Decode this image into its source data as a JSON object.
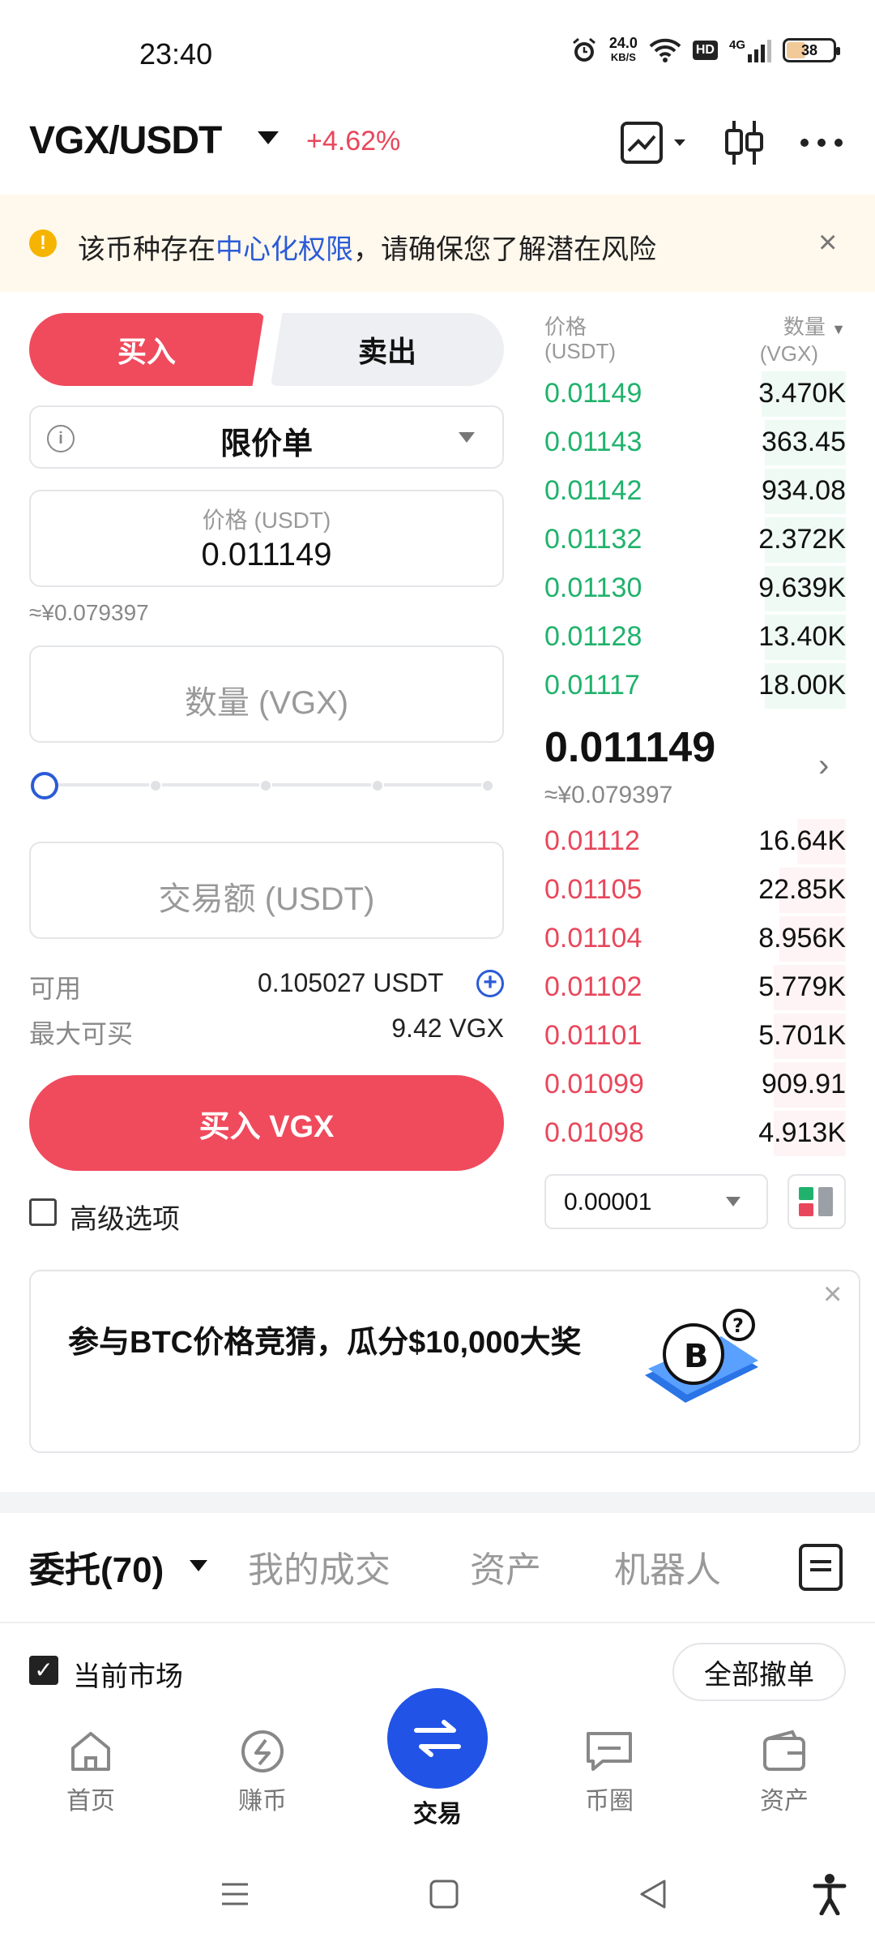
{
  "status_bar": {
    "time": "23:40",
    "net_speed_top": "24.0",
    "net_speed_unit": "KB/S",
    "hd": "HD",
    "network": "4G",
    "battery": "38"
  },
  "header": {
    "pair": "VGX/USDT",
    "change": "+4.62%"
  },
  "notice": {
    "text_before": "该币种存在",
    "link": "中心化权限",
    "text_after": "，请确保您了解潜在风险"
  },
  "order_form": {
    "buy_tab": "买入",
    "sell_tab": "卖出",
    "order_type": "限价单",
    "price_placeholder": "价格 (USDT)",
    "price_value": "0.011149",
    "price_cny": "≈¥0.079397",
    "qty_placeholder": "数量 (VGX)",
    "amount_placeholder": "交易额 (USDT)",
    "available_label": "可用",
    "available_value": "0.105027 USDT",
    "max_buy_label": "最大可买",
    "max_buy_value": "9.42 VGX",
    "buy_button": "买入 VGX",
    "advanced_label": "高级选项",
    "slider_position": 0
  },
  "orderbook": {
    "price_header": "价格",
    "price_unit": "(USDT)",
    "qty_header": "数量",
    "qty_unit": "(VGX)",
    "asks": [
      {
        "price": "0.01149",
        "qty": "3.470K",
        "depth": 0.28
      },
      {
        "price": "0.01143",
        "qty": "363.45",
        "depth": 0.27
      },
      {
        "price": "0.01142",
        "qty": "934.08",
        "depth": 0.27
      },
      {
        "price": "0.01132",
        "qty": "2.372K",
        "depth": 0.27
      },
      {
        "price": "0.01130",
        "qty": "9.639K",
        "depth": 0.27
      },
      {
        "price": "0.01128",
        "qty": "13.40K",
        "depth": 0.27
      },
      {
        "price": "0.01117",
        "qty": "18.00K",
        "depth": 0.27
      }
    ],
    "last_price": "0.011149",
    "last_price_cny": "≈¥0.079397",
    "bids": [
      {
        "price": "0.01112",
        "qty": "16.64K",
        "depth": 0.16
      },
      {
        "price": "0.01105",
        "qty": "22.85K",
        "depth": 0.22
      },
      {
        "price": "0.01104",
        "qty": "8.956K",
        "depth": 0.22
      },
      {
        "price": "0.01102",
        "qty": "5.779K",
        "depth": 0.24
      },
      {
        "price": "0.01101",
        "qty": "5.701K",
        "depth": 0.24
      },
      {
        "price": "0.01099",
        "qty": "909.91",
        "depth": 0.24
      },
      {
        "price": "0.01098",
        "qty": "4.913K",
        "depth": 0.24
      }
    ],
    "precision": "0.00001"
  },
  "banner": {
    "text": "参与BTC价格竞猜，瓜分$10,000大奖"
  },
  "bottom_tabs": {
    "orders": "委托(70)",
    "trades": "我的成交",
    "assets": "资产",
    "bot": "机器人"
  },
  "filter": {
    "current_market": "当前市场",
    "cancel_all": "全部撤单"
  },
  "nav": {
    "home": "首页",
    "earn": "赚币",
    "trade": "交易",
    "feed": "币圈",
    "assets": "资产"
  },
  "colors": {
    "buy": "#f04a5d",
    "ask": "#20b26c",
    "bid": "#e8475b",
    "accent": "#2a5bd7",
    "trade_nav": "#2153e6"
  }
}
